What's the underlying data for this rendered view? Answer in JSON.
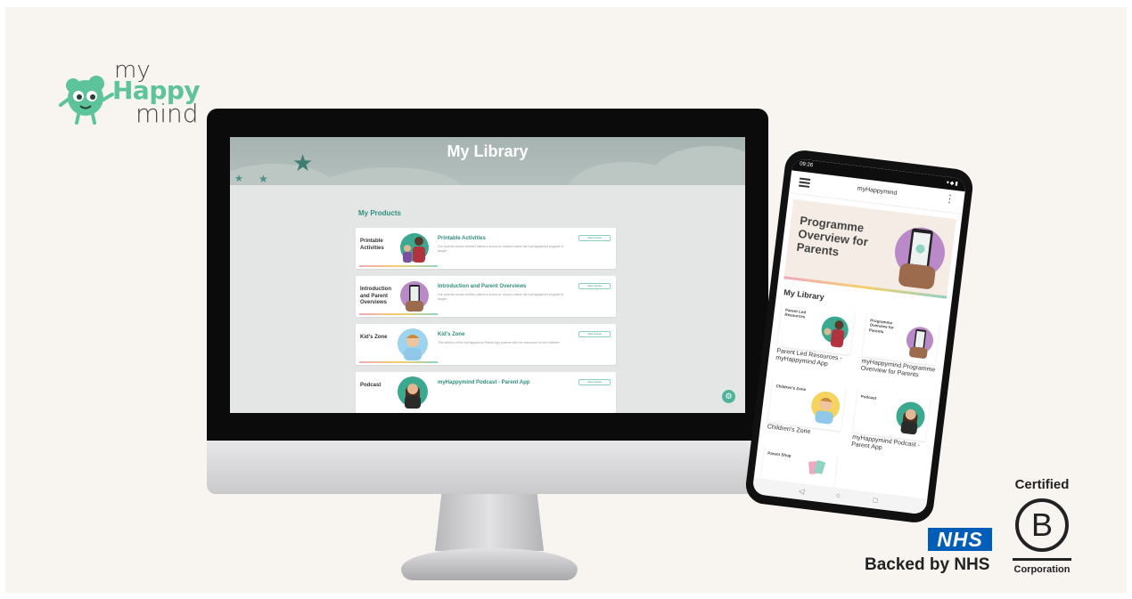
{
  "logo": {
    "line1": "my",
    "line2": "Happy",
    "line3": "mind"
  },
  "desktop": {
    "header_title": "My Library",
    "products_heading": "My Products",
    "cards": [
      {
        "label": "Printable Activities",
        "title": "Printable Activities",
        "description": "Our parents whose children attend a school or nursery where the myHappymind program is taught.",
        "button": "View Course"
      },
      {
        "label": "Introduction and Parent Overviews",
        "title": "Introduction and Parent Overviews",
        "description": "Our parents whose children attend a school or nursery where the myHappymind program is taught.",
        "button": "View Course"
      },
      {
        "label": "Kid's Zone",
        "title": "Kid's Zone",
        "description": "This section of the myHappymind Parent App parents with fun resources for the children!",
        "button": "View Course"
      },
      {
        "label": "Podcast",
        "title": "myHappymind Podcast - Parent App",
        "description": "",
        "button": "View Course"
      }
    ]
  },
  "phone": {
    "status_time": "09:26",
    "app_title": "myHappymind",
    "hero_text": "Programme Overview for Parents",
    "library_heading": "My Library",
    "tiles": [
      {
        "label": "Parent Led Resources",
        "caption": "Parent Led Resources - myHappymind App"
      },
      {
        "label": "Programme Overview for Parents",
        "caption": "myHappymind Programme Overview for Parents"
      },
      {
        "label": "Children's Zone",
        "caption": "Children's Zone"
      },
      {
        "label": "Podcast",
        "caption": "myHappymind Podcast - Parent App"
      },
      {
        "label": "Parent Shop",
        "caption": ""
      }
    ]
  },
  "badges": {
    "nhs_logo": "NHS",
    "nhs_caption": "Backed by NHS",
    "bcorp_certified": "Certified",
    "bcorp_letter": "B",
    "bcorp_corporation": "Corporation"
  },
  "colors": {
    "brand_green": "#5cc39b",
    "teal_text": "#2f8f80",
    "nhs_blue": "#005eb8",
    "background": "#f8f4f0"
  }
}
